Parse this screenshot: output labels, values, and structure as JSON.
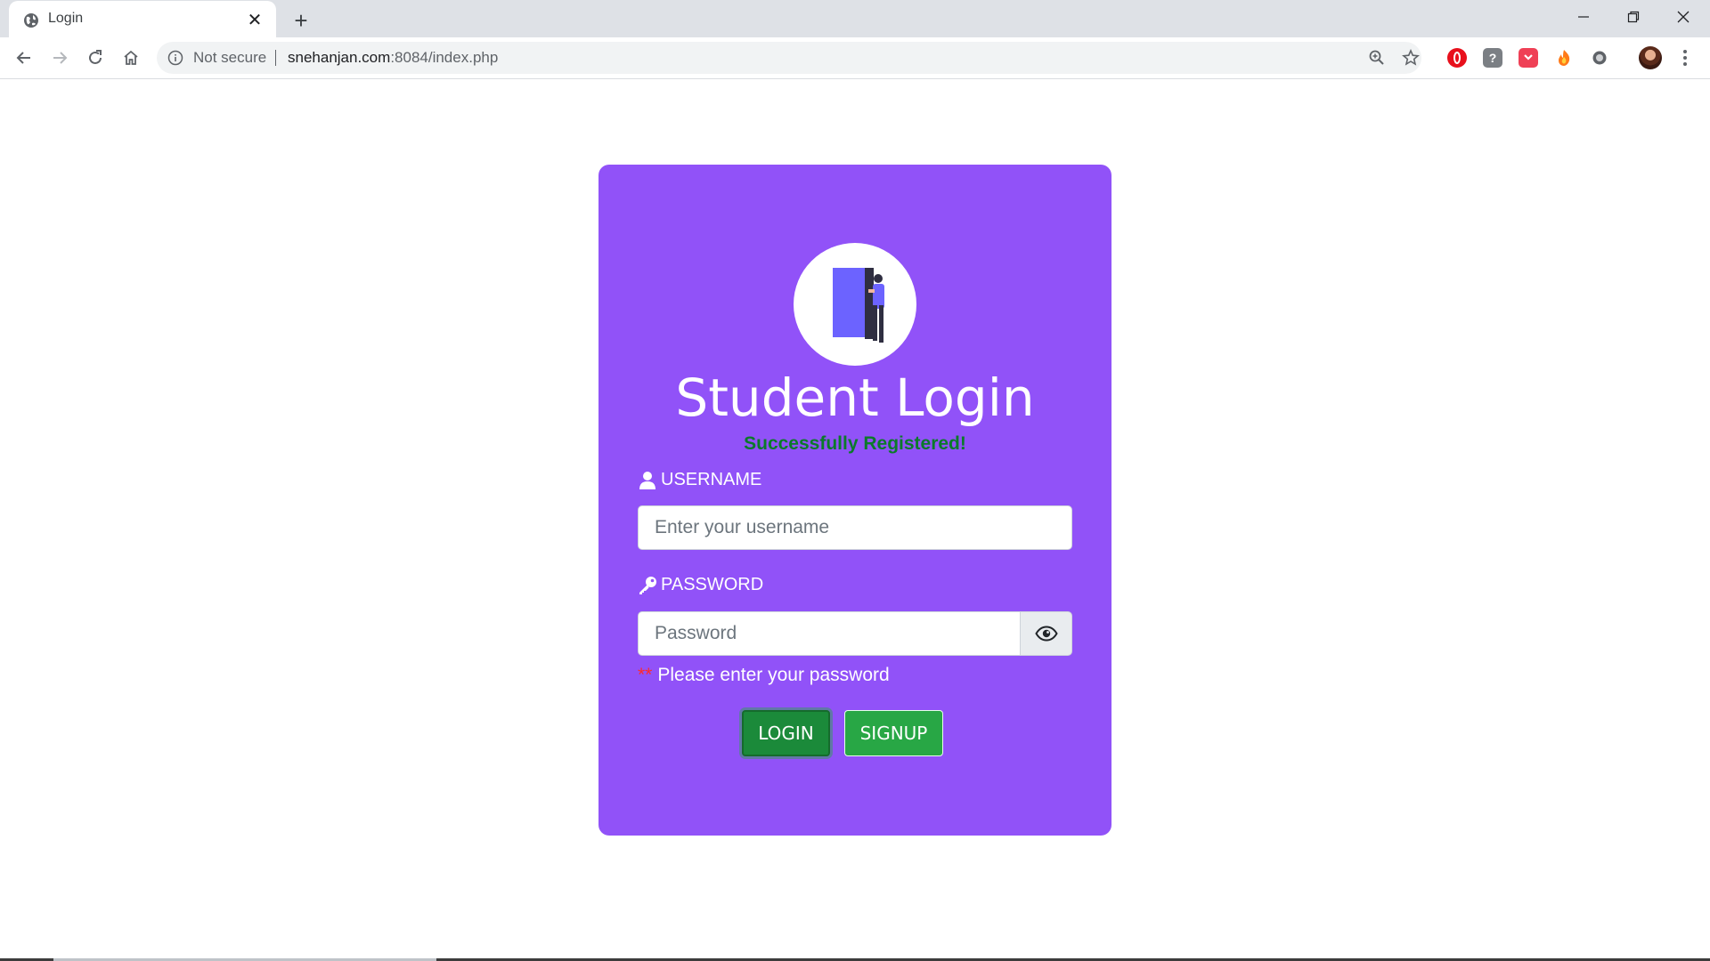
{
  "browser": {
    "tab_title": "Login",
    "new_tab_label": "+",
    "security_label": "Not secure",
    "url_host": "snehanjan.com",
    "url_path": ":8084/index.php",
    "extensions": [
      "opera-icon",
      "help-extension-icon",
      "pocket-icon",
      "fire-extension-icon",
      "record-extension-icon"
    ]
  },
  "login": {
    "heading": "Student Login",
    "success_message": "Successfully Registered!",
    "username_label": "USERNAME",
    "username_placeholder": "Enter your username",
    "username_value": "",
    "password_label": "PASSWORD",
    "password_placeholder": "Password",
    "password_value": "",
    "required_marker": "**",
    "password_hint": "Please enter your password",
    "login_button": "LOGIN",
    "signup_button": "SIGNUP"
  },
  "colors": {
    "card": "#9152f8",
    "success": "#0b7a2a",
    "login_button": "#1b8a3a",
    "signup_button": "#28a745",
    "required_marker": "#ff2a2a"
  }
}
